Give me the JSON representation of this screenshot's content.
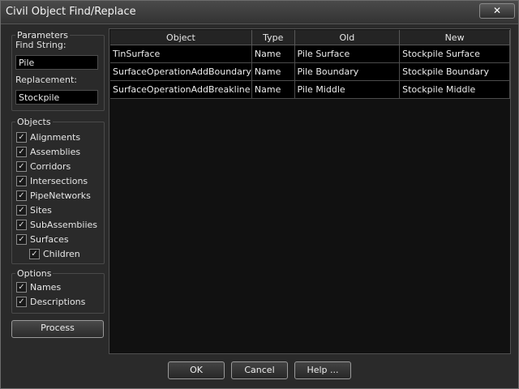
{
  "window": {
    "title": "Civil Object Find/Replace",
    "close_glyph": "✕"
  },
  "parameters": {
    "legend": "Parameters",
    "find_label": "Find String:",
    "find_value": "Pile",
    "replace_label": "Replacement:",
    "replace_value": "Stockpile"
  },
  "objects": {
    "legend": "Objects",
    "items": [
      {
        "label": "Alignments",
        "checked": true
      },
      {
        "label": "Assemblies",
        "checked": true
      },
      {
        "label": "Corridors",
        "checked": true
      },
      {
        "label": "Intersections",
        "checked": true
      },
      {
        "label": "PipeNetworks",
        "checked": true
      },
      {
        "label": "Sites",
        "checked": true
      },
      {
        "label": "SubAssembiies",
        "checked": true
      },
      {
        "label": "Surfaces",
        "checked": true
      },
      {
        "label": "Children",
        "checked": true
      }
    ]
  },
  "options": {
    "legend": "Options",
    "items": [
      {
        "label": "Names",
        "checked": true
      },
      {
        "label": "Descriptions",
        "checked": true
      }
    ]
  },
  "process_label": "Process",
  "grid": {
    "columns": [
      "Object",
      "Type",
      "Old",
      "New"
    ],
    "rows": [
      [
        "TinSurface",
        "Name",
        "Pile Surface",
        "Stockpile Surface"
      ],
      [
        "SurfaceOperationAddBoundary",
        "Name",
        "Pile Boundary",
        "Stockpile Boundary"
      ],
      [
        "SurfaceOperationAddBreakline",
        "Name",
        "Pile Middle",
        "Stockpile Middle"
      ]
    ]
  },
  "footer": {
    "ok": "OK",
    "cancel": "Cancel",
    "help": "Help ..."
  },
  "check_glyph": "✓"
}
